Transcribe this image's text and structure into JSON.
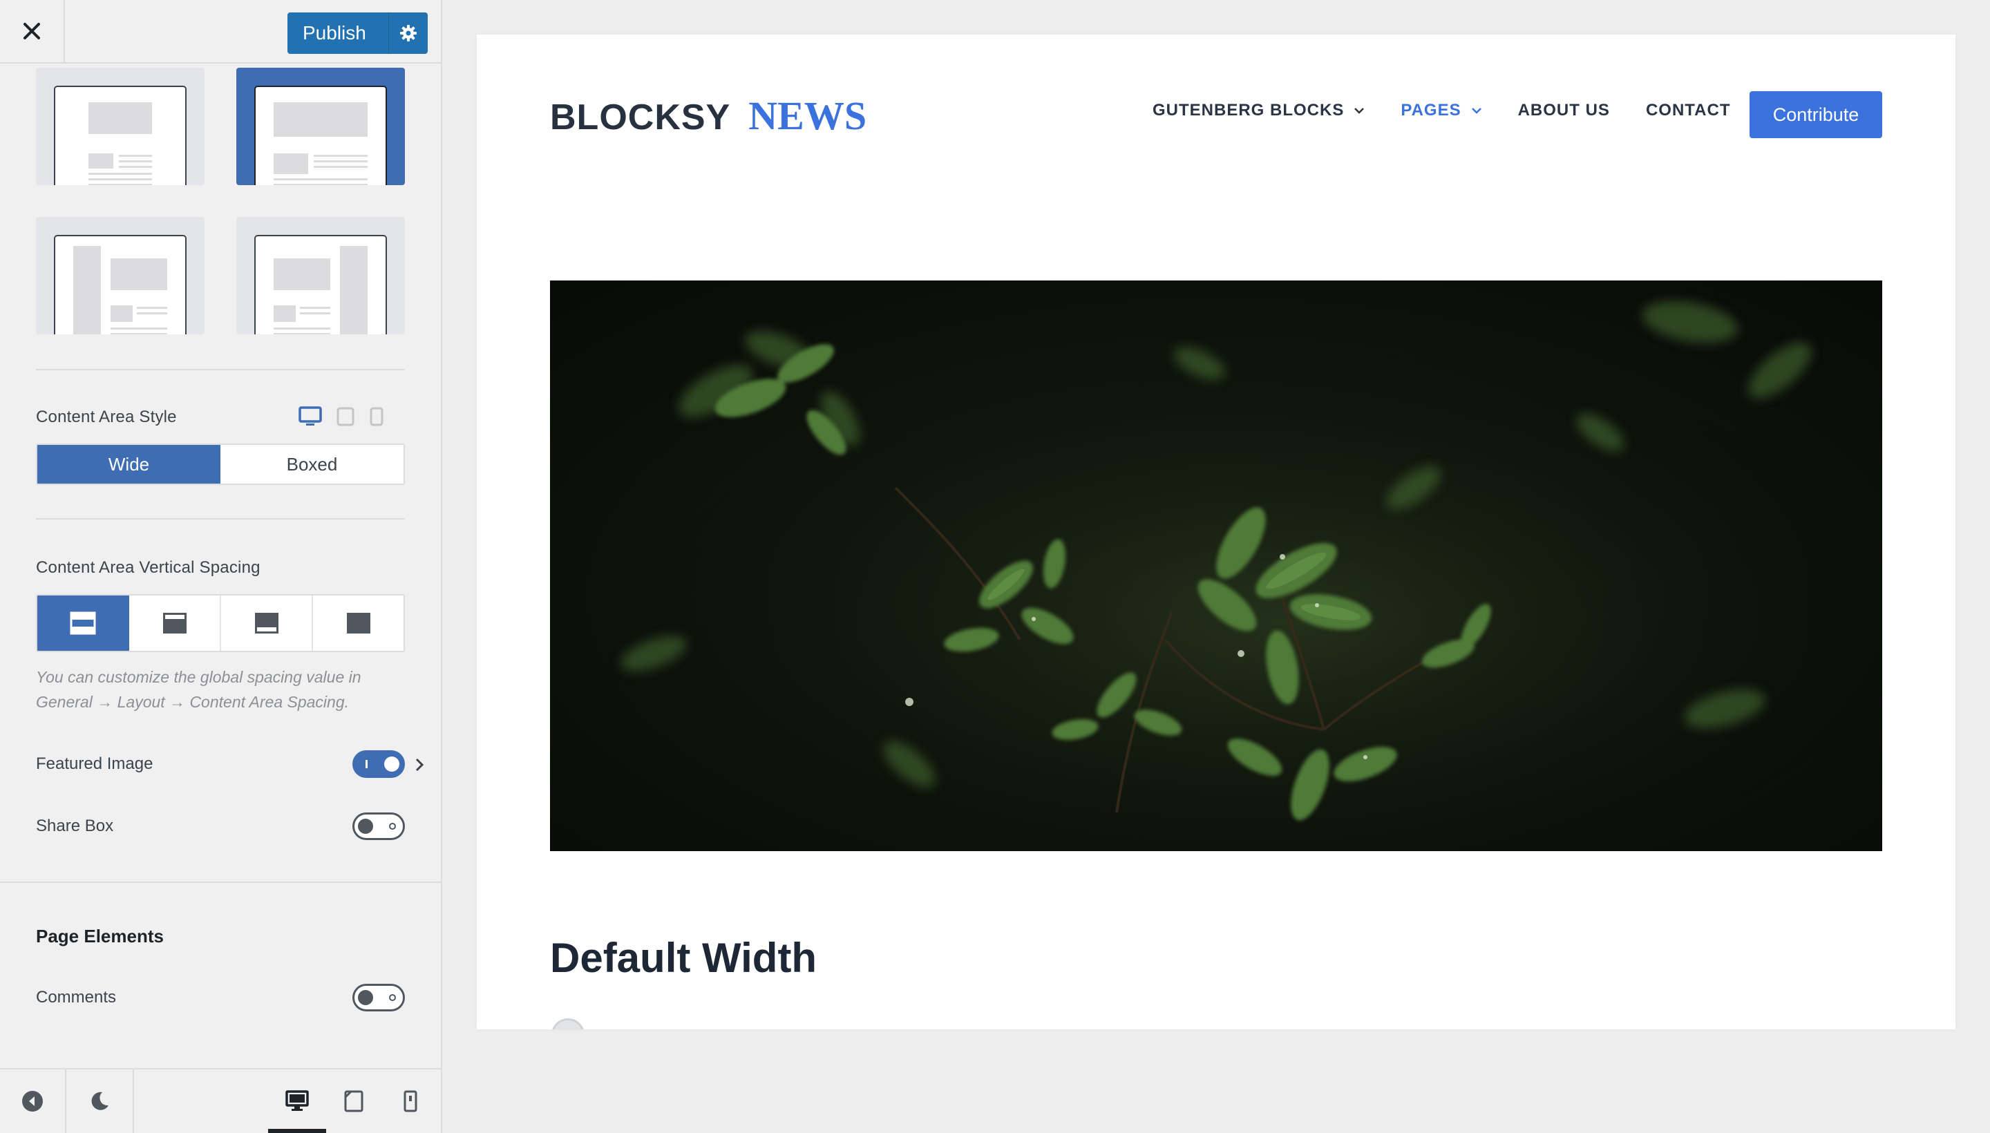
{
  "sidebar": {
    "header": {
      "close_icon": "close-icon",
      "publish_label": "Publish",
      "settings_icon": "gear-icon"
    },
    "layout_options": [
      {
        "name": "no-sidebar-narrow",
        "selected": false
      },
      {
        "name": "no-sidebar-wide",
        "selected": true
      },
      {
        "name": "left-sidebar",
        "selected": false
      },
      {
        "name": "right-sidebar",
        "selected": false
      }
    ],
    "content_area_style": {
      "label": "Content Area Style",
      "options": [
        "Wide",
        "Boxed"
      ],
      "selected": "Wide",
      "device_icons": [
        "desktop-icon",
        "tablet-icon",
        "mobile-icon"
      ]
    },
    "vertical_spacing": {
      "label": "Content Area Vertical Spacing",
      "selected_index": 0,
      "hint": "You can customize the global spacing value in General → Layout → Content Area Spacing."
    },
    "featured_image": {
      "label": "Featured Image",
      "enabled": true
    },
    "share_box": {
      "label": "Share Box",
      "enabled": false
    },
    "page_elements": {
      "title": "Page Elements",
      "comments": {
        "label": "Comments",
        "enabled": false
      }
    },
    "footer": {
      "icons": [
        "collapse-icon",
        "dark-mode-icon",
        "desktop-icon",
        "tablet-icon",
        "mobile-icon"
      ],
      "active_device": "desktop"
    }
  },
  "preview": {
    "logo": {
      "part1": "BLOCKSY",
      "part2": "NEWS"
    },
    "nav": [
      {
        "label": "GUTENBERG BLOCKS",
        "dropdown": true,
        "active": false
      },
      {
        "label": "PAGES",
        "dropdown": true,
        "active": true
      },
      {
        "label": "ABOUT US",
        "dropdown": false,
        "active": false
      },
      {
        "label": "CONTACT",
        "dropdown": false,
        "active": false
      }
    ],
    "cta_label": "Contribute",
    "post_title": "Default Width",
    "colors": {
      "accent": "#3b72dd",
      "sidebar_selected": "#3e6db3",
      "publish": "#2271b1"
    }
  }
}
